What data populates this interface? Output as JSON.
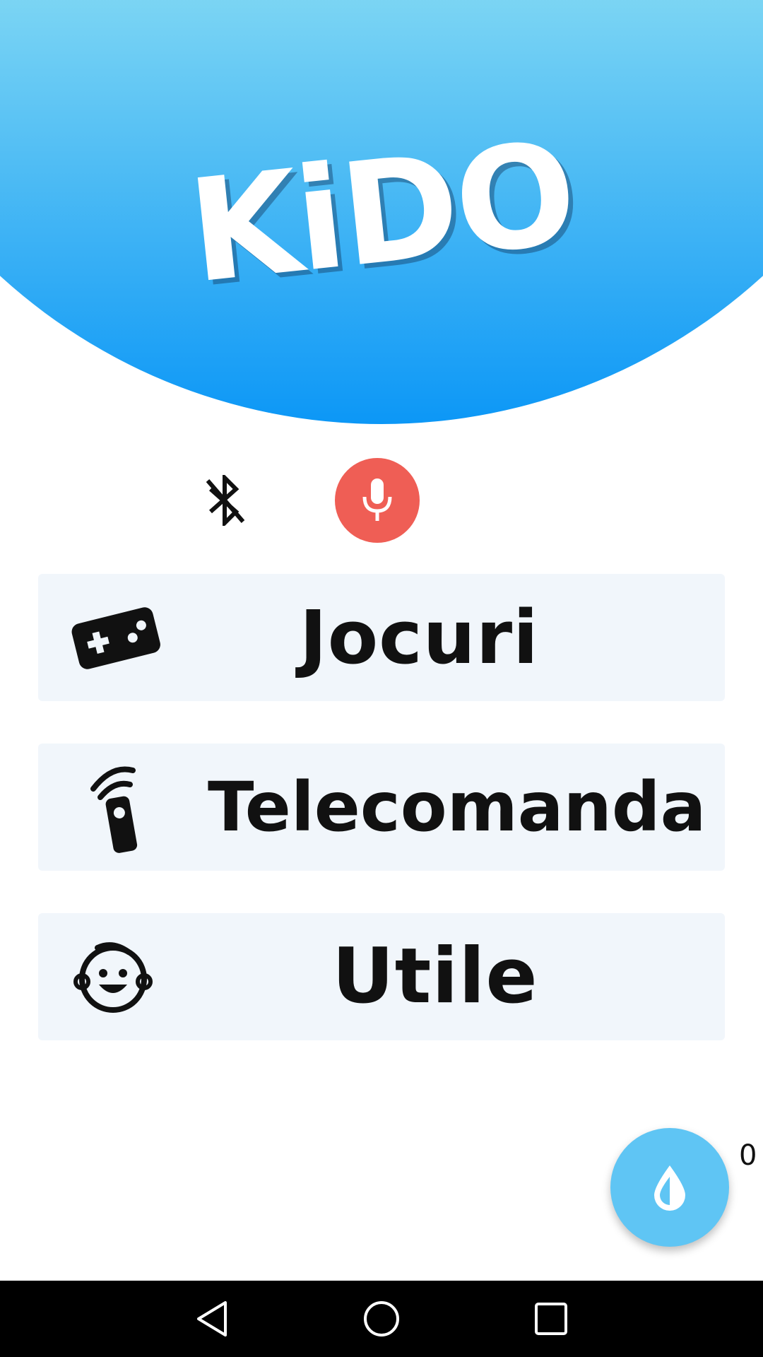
{
  "header": {
    "logo_text": "KiDO"
  },
  "controls": {
    "bluetooth_icon": "bluetooth-disabled-icon",
    "mic_icon": "microphone-icon",
    "mic_color": "#ef5e55"
  },
  "menu": {
    "items": [
      {
        "label": "Jocuri",
        "icon": "gamepad-icon"
      },
      {
        "label": "Telecomanda",
        "icon": "remote-control-icon"
      },
      {
        "label": "Utile",
        "icon": "baby-face-icon"
      }
    ]
  },
  "fab": {
    "icon": "water-drop-icon",
    "count": "0",
    "color": "#5fc5f4"
  },
  "nav": {
    "back_icon": "back-triangle-icon",
    "home_icon": "home-circle-icon",
    "recents_icon": "recents-square-icon"
  },
  "colors": {
    "header_top": "#88dcf3",
    "header_bottom": "#0c97f6",
    "card_background": "#f1f6fb"
  }
}
